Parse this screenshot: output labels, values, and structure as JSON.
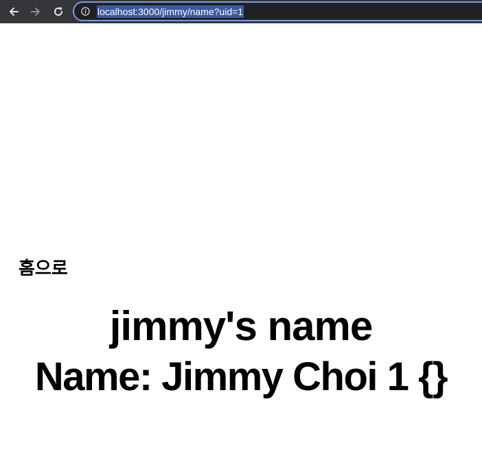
{
  "browser": {
    "url": "localhost:3000/jimmy/name?uid=1",
    "icons": {
      "back": "arrow-left-icon",
      "forward": "arrow-right-icon",
      "reload": "reload-icon",
      "site_info": "info-icon"
    },
    "colors": {
      "toolbar": "#35363a",
      "omnibox_border": "#7c9be6",
      "url_selection": "#3d5a9e"
    }
  },
  "page": {
    "home_link": "홈으로",
    "heading": "jimmy's name",
    "name_line": "Name: Jimmy Choi 1 {}"
  }
}
